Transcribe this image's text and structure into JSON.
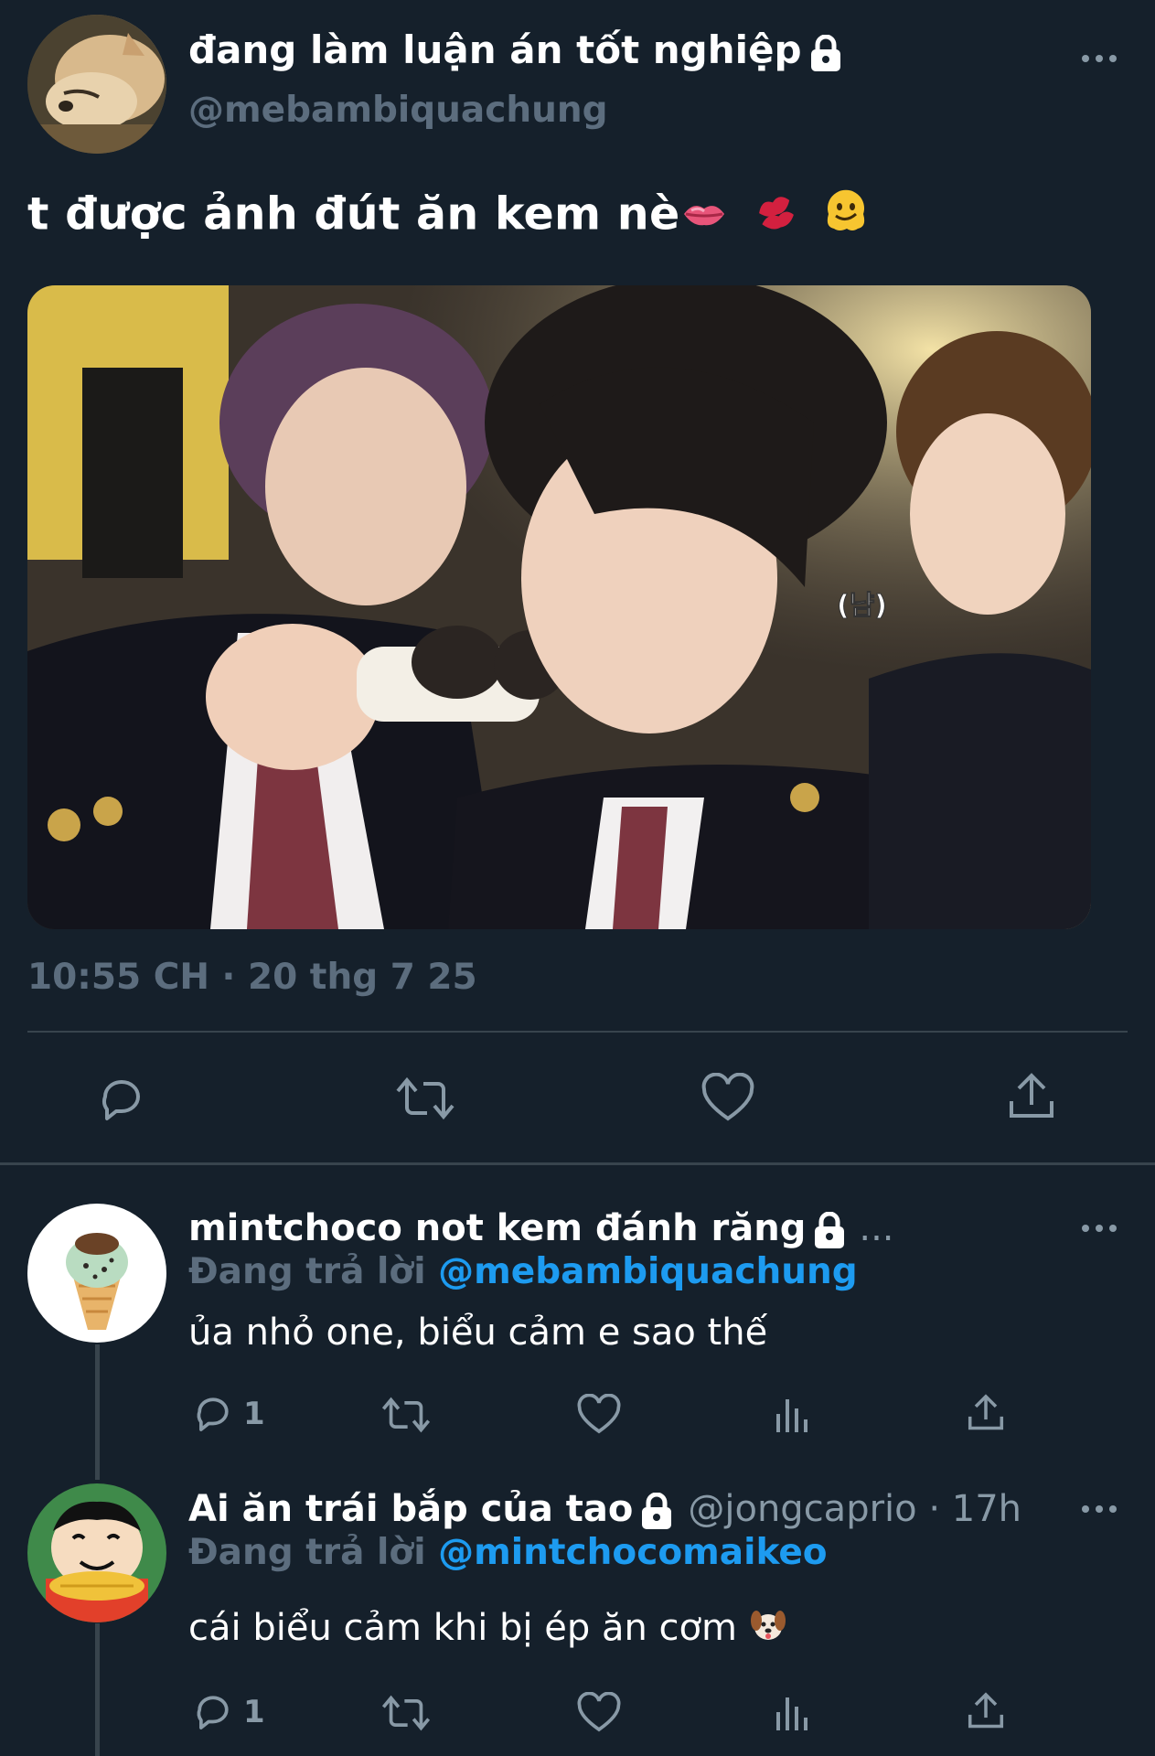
{
  "main_tweet": {
    "display_name": "đang làm luận án tốt nghiệp",
    "handle": "@mebambiquachung",
    "text": "t được ảnh đút ăn kem nè",
    "text_emojis": [
      "lips-emoji",
      "kiss-mark-emoji",
      "melting-face-emoji"
    ],
    "timestamp": "10:55 CH · 20 thg 7 25",
    "photo_caption": "(냠)"
  },
  "replies": [
    {
      "display_name": "mintchoco not kem đánh răng",
      "name_suffix": "...",
      "replying_label": "Đang trả lời",
      "replying_to": "@mebambiquachung",
      "text": "ủa nhỏ one, biểu cảm e sao thế",
      "reply_count": "1"
    },
    {
      "display_name": "Ai ăn trái bắp của tao",
      "meta": "@jongcaprio · 17h",
      "replying_label": "Đang trả lời",
      "replying_to": "@mintchocomaikeo",
      "text": "cái biểu cảm khi bị ép ăn cơm",
      "text_emoji": "dog-face-emoji",
      "reply_count": "1"
    }
  ],
  "colors": {
    "background": "#15202b",
    "divider": "#38444d",
    "secondary_text": "#5c6d7e",
    "icon": "#8899a6",
    "link": "#1d9bf0"
  }
}
